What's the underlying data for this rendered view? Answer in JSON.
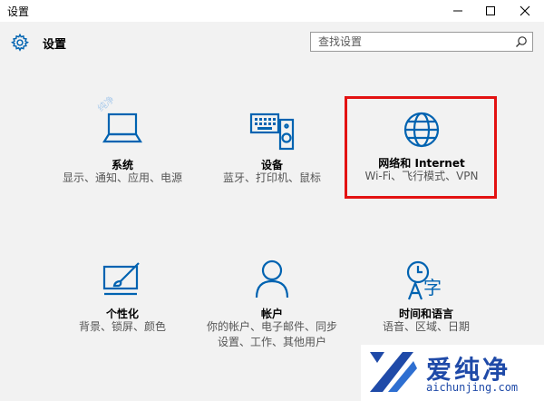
{
  "window": {
    "title": "设置"
  },
  "header": {
    "title": "设置",
    "search_placeholder": "查找设置"
  },
  "tiles": [
    {
      "title": "系统",
      "desc": "显示、通知、应用、电源"
    },
    {
      "title": "设备",
      "desc": "蓝牙、打印机、鼠标"
    },
    {
      "title": "网络和 Internet",
      "desc": "Wi-Fi、飞行模式、VPN"
    },
    {
      "title": "个性化",
      "desc": "背景、锁屏、颜色"
    },
    {
      "title": "帐户",
      "desc": "你的帐户、电子邮件、同步设置、工作、其他用户"
    },
    {
      "title": "时间和语言",
      "desc": "语音、区域、日期"
    }
  ],
  "watermark": {
    "brand": "爱纯净",
    "url": "aichunjing.com",
    "small": "纯净"
  },
  "colors": {
    "accent": "#0063b1",
    "highlight": "#e31212",
    "watermark": "#1f4aa8"
  }
}
